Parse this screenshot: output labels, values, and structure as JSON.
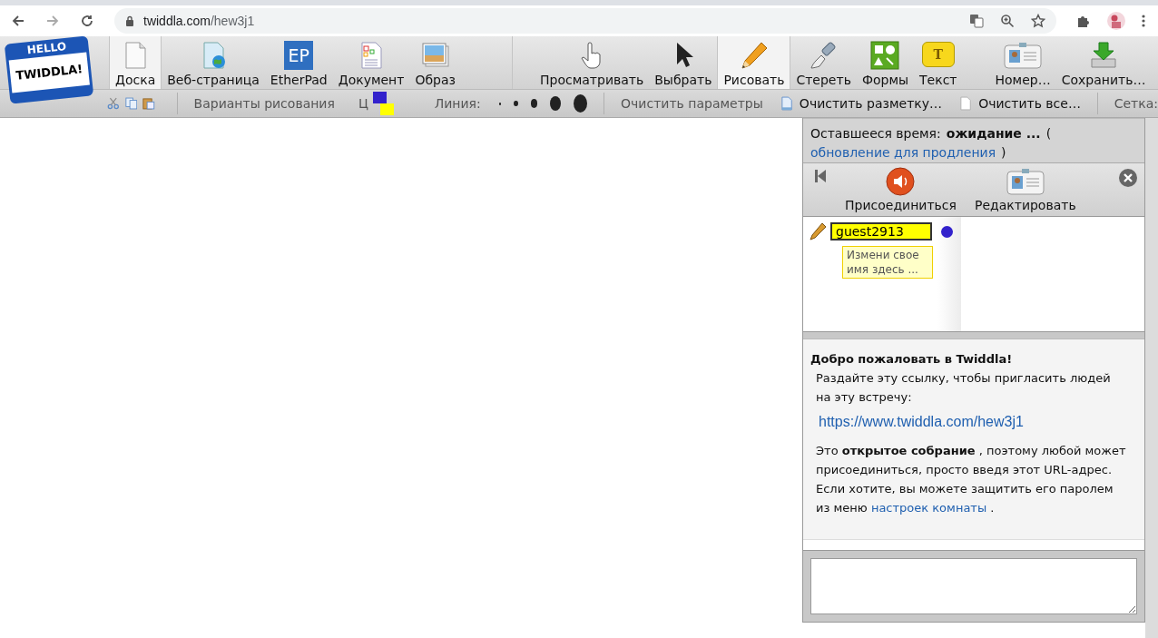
{
  "browser": {
    "url_host": "twiddla.com",
    "url_path": "/hew3j1"
  },
  "logo": {
    "top": "HELLO",
    "bottom": "TWIDDLA!"
  },
  "tool_groups": [
    {
      "tools": [
        {
          "label": "Доска",
          "kind": "page",
          "selected": true
        },
        {
          "label": "Веб-страница",
          "kind": "web",
          "selected": false
        },
        {
          "label": "EtherPad",
          "kind": "ep",
          "selected": false
        },
        {
          "label": "Документ",
          "kind": "doc",
          "selected": false
        },
        {
          "label": "Образ",
          "kind": "image",
          "selected": false
        }
      ]
    },
    {
      "tools": [
        {
          "label": "Просматривать",
          "kind": "hand",
          "selected": false
        },
        {
          "label": "Выбрать",
          "kind": "pointer",
          "selected": false
        },
        {
          "label": "Рисовать",
          "kind": "pencil",
          "selected": true
        },
        {
          "label": "Стереть",
          "kind": "eraser",
          "selected": false
        },
        {
          "label": "Формы",
          "kind": "shapes",
          "selected": false
        },
        {
          "label": "Текст",
          "kind": "text",
          "selected": false
        }
      ]
    },
    {
      "tools": [
        {
          "label": "Номер…",
          "kind": "badge",
          "selected": false
        },
        {
          "label": "Сохранить…",
          "kind": "save",
          "selected": false
        }
      ]
    }
  ],
  "ep_icon_text": "EP",
  "text_icon_text": "T",
  "options_bar": {
    "drawing_options": "Варианты рисования",
    "color_label": "Ц",
    "colors": [
      {
        "color": "#3322cc"
      },
      {
        "color": "#ffff00"
      }
    ],
    "line_label": "Линия:",
    "clear_options": "Очистить параметры",
    "clear_markup": "Очистить разметку…",
    "clear_all": "Очистить все…",
    "grid_label": "Сетка:"
  },
  "panel": {
    "time_label": "Оставшееся время:",
    "time_value": "ожидание ...",
    "renew_open": "(",
    "renew_link": "обновление для продления",
    "renew_close": ")",
    "join": "Присоединиться",
    "edit": "Редактировать",
    "user": {
      "name": "guest2913",
      "color": "#3322cc"
    },
    "tooltip": "Измени свое имя здесь ...",
    "welcome_title": "Добро пожаловать в Twiddla!",
    "invite_text": "Раздайте эту ссылку, чтобы пригласить людей на эту встречу:",
    "invite_link": "https://www.twiddla.com/hew3j1",
    "info_text": "Это **открытое собрание** , поэтому любой может присоединиться, просто введя этот URL-адрес. Если хотите, вы можете защитить его паролем из меню",
    "settings_link": "настроек комнаты",
    "info_end": "."
  }
}
